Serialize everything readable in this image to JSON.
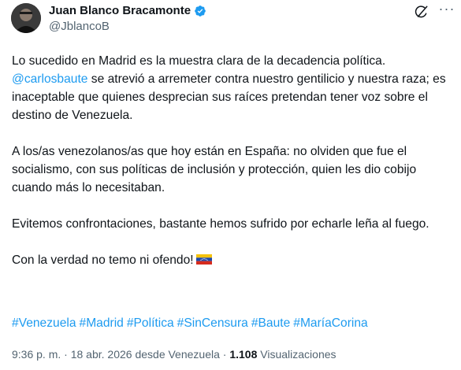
{
  "author": {
    "name": "Juan Blanco Bracamonte",
    "handle": "@JblancoB",
    "verified": true
  },
  "tweet": {
    "p1_text": "Lo sucedido en Madrid es la muestra clara de la decadencia política.",
    "p1_mention": "@carlosbaute",
    "p1_rest": " se atrevió a arremeter contra nuestro gentilicio y nuestra raza; es inaceptable que quienes desprecian sus raíces pretendan tener voz sobre el destino de Venezuela.",
    "p2": "A los/as venezolanos/as que hoy están en España: no olviden que fue el socialismo, con sus políticas de inclusión y protección, quien les dio cobijo cuando más lo necesitaban.",
    "p3": "Evitemos confrontaciones, bastante hemos sufrido por echarle leña al fuego.",
    "p4": "Con la verdad no temo ni ofendo!",
    "hashtags": [
      "#Venezuela",
      "#Madrid",
      "#Política",
      "#SinCensura",
      "#Baute",
      "#MaríaCorina"
    ]
  },
  "meta": {
    "time": "9:36 p. m.",
    "separator": "·",
    "date_location": "18 abr. 2026 desde Venezuela",
    "views_count": "1.108",
    "views_label": "Visualizaciones"
  },
  "icons": {
    "verified": "verified-badge-icon",
    "grok": "grok-icon",
    "more": "more-options-icon",
    "flag": "venezuela-flag-icon"
  },
  "colors": {
    "link": "#1d9bf0",
    "text": "#0f1419",
    "muted": "#536471"
  }
}
